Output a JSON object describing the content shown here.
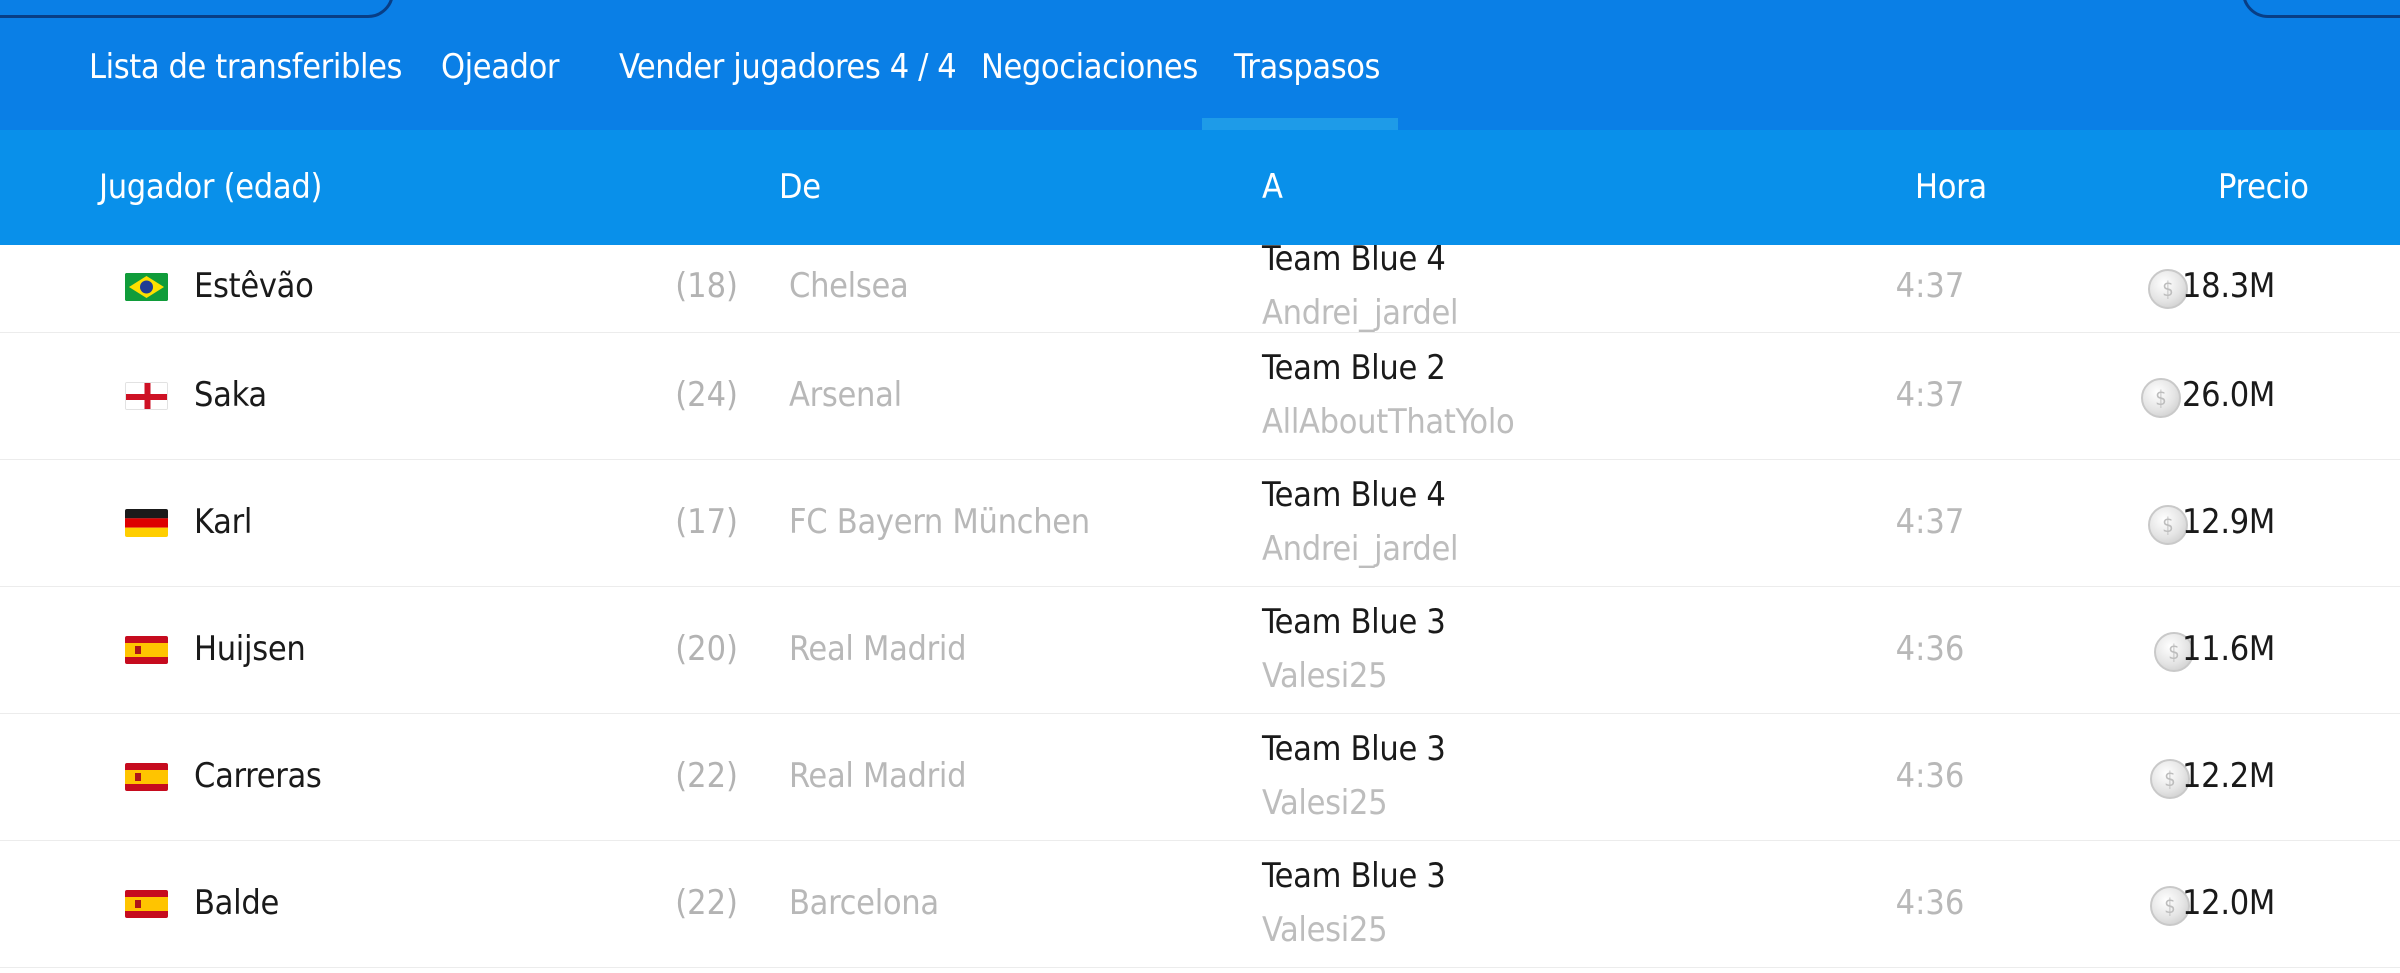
{
  "tabs": [
    {
      "label": "Lista de transferibles"
    },
    {
      "label": "Ojeador"
    },
    {
      "label": "Vender jugadores 4 / 4"
    },
    {
      "label": "Negociaciones"
    },
    {
      "label": "Traspasos"
    }
  ],
  "active_tab": "Traspasos",
  "columns": {
    "player": "Jugador (edad)",
    "from": "De",
    "to": "A",
    "time": "Hora",
    "price": "Precio"
  },
  "colors": {
    "nav_bg": "#0a7fe6",
    "header_bg": "#0990ea",
    "active_tab_underline": "#1e9be8"
  },
  "coin_icon": "coin-icon",
  "rows": [
    {
      "flag": "brazil-flag-icon",
      "name": "Estêvão",
      "age": "(18)",
      "from": "Chelsea",
      "team": "Team Blue 4",
      "manager": "Andrei_jardel",
      "time": "4:37",
      "price": "18.3M"
    },
    {
      "flag": "england-flag-icon",
      "name": "Saka",
      "age": "(24)",
      "from": "Arsenal",
      "team": "Team Blue 2",
      "manager": "AllAboutThatYolo",
      "time": "4:37",
      "price": "26.0M"
    },
    {
      "flag": "germany-flag-icon",
      "name": "Karl",
      "age": "(17)",
      "from": "FC Bayern München",
      "team": "Team Blue 4",
      "manager": "Andrei_jardel",
      "time": "4:37",
      "price": "12.9M"
    },
    {
      "flag": "spain-flag-icon",
      "name": "Huijsen",
      "age": "(20)",
      "from": "Real Madrid",
      "team": "Team Blue 3",
      "manager": "Valesi25",
      "time": "4:36",
      "price": "11.6M"
    },
    {
      "flag": "spain-flag-icon",
      "name": "Carreras",
      "age": "(22)",
      "from": "Real Madrid",
      "team": "Team Blue 3",
      "manager": "Valesi25",
      "time": "4:36",
      "price": "12.2M"
    },
    {
      "flag": "spain-flag-icon",
      "name": "Balde",
      "age": "(22)",
      "from": "Barcelona",
      "team": "Team Blue 3",
      "manager": "Valesi25",
      "time": "4:36",
      "price": "12.0M"
    }
  ]
}
